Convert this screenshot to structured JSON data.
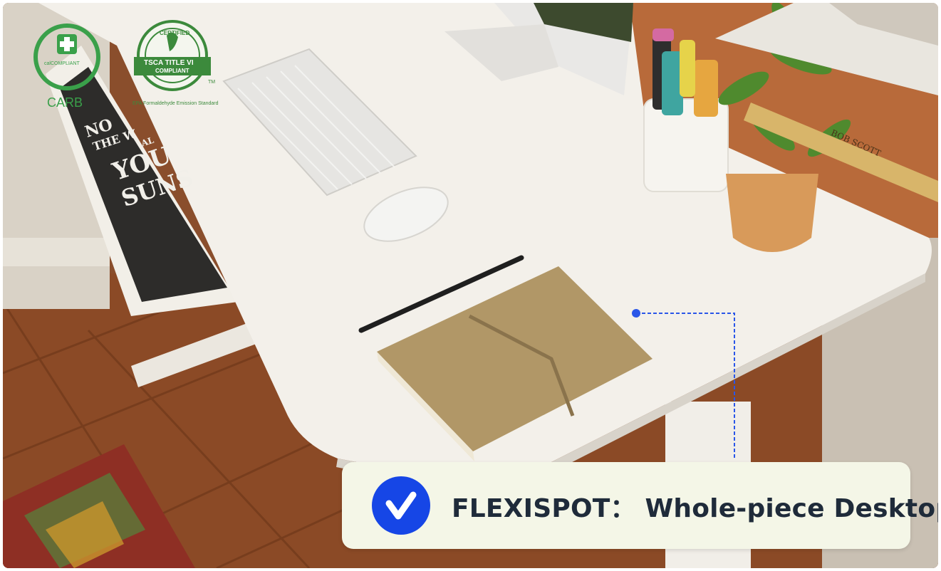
{
  "badges": {
    "calcompliant": {
      "top_text": "calCOMPLIANT",
      "label": "CARB",
      "color": "#3aa04a"
    },
    "tsca": {
      "arc_text": "CERTIFIED",
      "line1": "TSCA TITLE VI",
      "line2": "COMPLIANT",
      "tm": "TM",
      "caption": "EPA Formaldehyde Emission Standard",
      "color": "#3c8a3c"
    }
  },
  "poster": {
    "lines": [
      "NO",
      "THE W",
      "AL",
      "YOU",
      "SUNS"
    ]
  },
  "book_spines": [
    "BOB SCOTT"
  ],
  "callout": {
    "text": "FLEXISPOT：  Whole-piece Desktop",
    "icon": "checkmark-icon",
    "accent": "#1646e6",
    "background": "#f4f6e7"
  },
  "pointer": {
    "color": "#2a56e8"
  }
}
